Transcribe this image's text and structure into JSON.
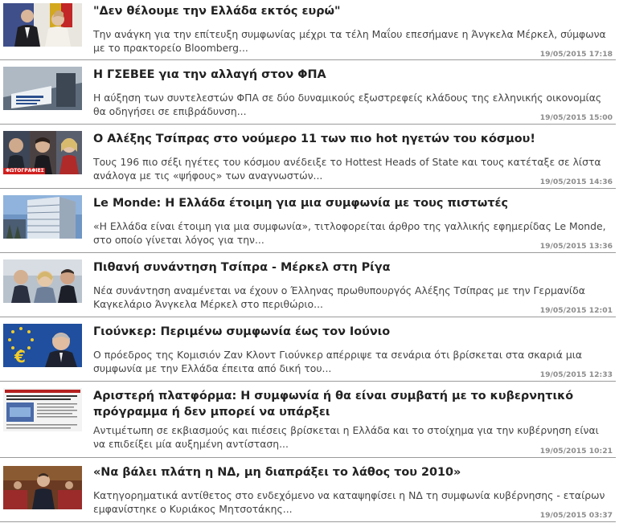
{
  "articles": [
    {
      "title": "\"Δεν θέλουμε την Ελλάδα εκτός ευρώ\"",
      "summary": "Την ανάγκη για την επίτευξη συμφωνίας μέχρι τα τέλη Μαΐου επεσήμανε η Άνγκελα Μέρκελ, σύμφωνα με το πρακτορείο Bloomberg...",
      "date": "19/05/2015 17:18",
      "thumbnail": "hollande-merkel-photo"
    },
    {
      "title": "Η ΓΣΕΒΕΕ για την αλλαγή στον ΦΠΑ",
      "summary": "Η αύξηση των συντελεστών ΦΠΑ σε δύο δυναμικούς εξωστρεφείς κλάδους της ελληνικής οικονομίας θα οδηγήσει σε επιβράδυνση...",
      "date": "19/05/2015 15:00",
      "thumbnail": "gsevee-sign-photo"
    },
    {
      "title": "Ο Αλέξης Τσίπρας στο νούμερο 11 των πιο hot ηγετών του κόσμου!",
      "summary": "Τους 196 πιο σέξι ηγέτες του κόσμου ανέδειξε το Hottest Heads of State και τους κατέταξε σε λίστα ανάλογα με τις «ψήφους» των αναγνωστών...",
      "date": "19/05/2015 14:36",
      "thumbnail": "leaders-collage-photo",
      "thumbnail_badge": "ΦΩΤΟΓΡΑΦΙΕΣ"
    },
    {
      "title": "Le Monde: Η Ελλάδα έτοιμη για μια συμφωνία με τους πιστωτές",
      "summary": "«Η Ελλάδα είναι έτοιμη για μια συμφωνία», τιτλοφορείται άρθρο της γαλλικής εφημερίδας Le Monde, στο οποίο γίνεται λόγος για την...",
      "date": "19/05/2015 13:36",
      "thumbnail": "le-monde-building-photo"
    },
    {
      "title": "Πιθανή συνάντηση Τσίπρα - Μέρκελ στη Ρίγα",
      "summary": "Νέα συνάντηση αναμένεται να έχουν ο Έλληνας πρωθυπουργός Αλέξης Τσίπρας με την Γερμανίδα Καγκελάριο Άνγκελα Μέρκελ στο περιθώριο...",
      "date": "19/05/2015 12:01",
      "thumbnail": "tsipras-merkel-photo"
    },
    {
      "title": "Γιούνκερ: Περιμένω συμφωνία έως τον Ιούνιο",
      "summary": "Ο πρόεδρος της Κομισιόν Ζαν Κλοντ Γιούνκερ απέρριψε τα σενάρια ότι βρίσκεται στα σκαριά μια συμφωνία με την Ελλάδα έπειτα από δική του...",
      "date": "19/05/2015 12:33",
      "thumbnail": "juncker-euro-photo"
    },
    {
      "title": "Αριστερή πλατφόρμα: Η συμφωνία ή θα είναι συμβατή με το κυβερνητικό πρόγραμμα ή δεν μπορεί να υπάρξει",
      "summary": "Αντιμέτωπη σε εκβιασμούς και πιέσεις βρίσκεται η Ελλάδα και το στοίχημα για την κυβέρνηση είναι να επιδείξει μία αυξημένη αντίσταση...",
      "date": "19/05/2015 10:21",
      "thumbnail": "newspaper-clipping-photo"
    },
    {
      "title": "«Να βάλει πλάτη η ΝΔ, μη διαπράξει το λάθος του 2010»",
      "summary": "Κατηγορηματικά αντίθετος στο ενδεχόμενο να καταψηφίσει η ΝΔ τη συμφωνία κυβέρνησης - εταίρων εμφανίστηκε ο Κυριάκος Μητσοτάκης...",
      "date": "19/05/2015 03:37",
      "thumbnail": "mitsotakis-parliament-photo"
    }
  ]
}
